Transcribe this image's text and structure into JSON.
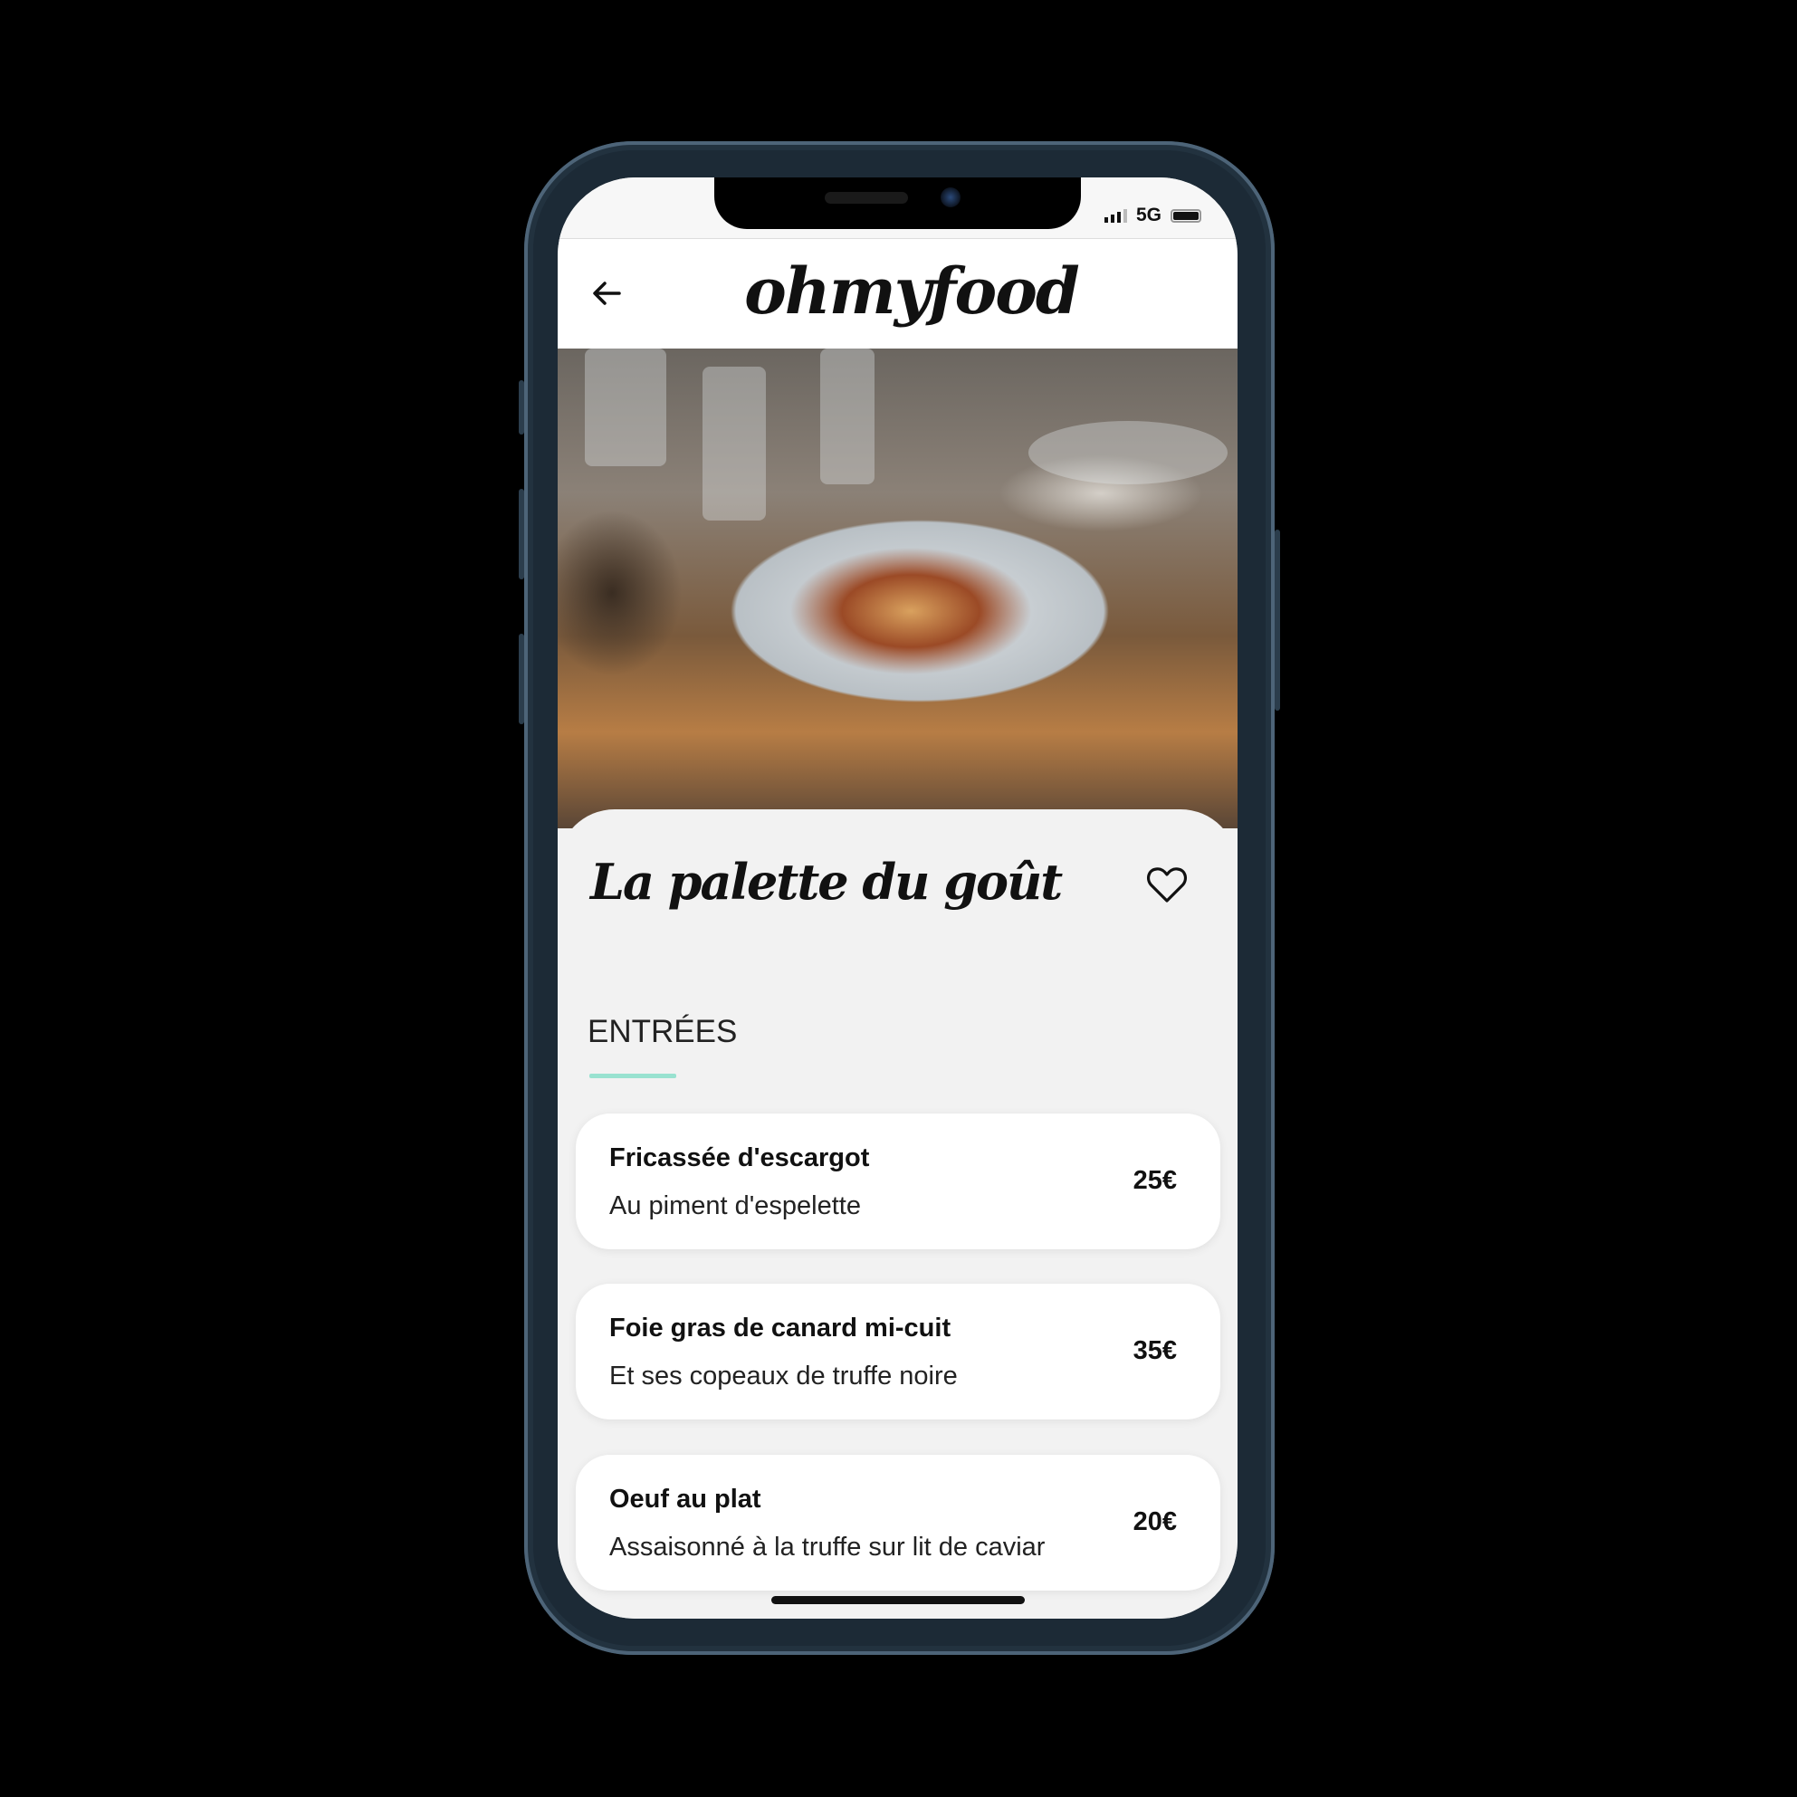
{
  "status_bar": {
    "network": "5G",
    "signal_icon": "signal-bars-icon",
    "battery_icon": "battery-icon"
  },
  "header": {
    "back_icon": "arrow-left-icon",
    "logo": "ohmyfood"
  },
  "restaurant": {
    "name": "La palette du goût",
    "favorite_icon": "heart-outline-icon"
  },
  "section": {
    "title": "ENTRÉES",
    "accent_color": "#99e2d0"
  },
  "menu": [
    {
      "name": "Fricassée d'escargot",
      "description": "Au piment d'espelette",
      "price": "25€"
    },
    {
      "name": "Foie gras de canard mi-cuit",
      "description": "Et ses copeaux de truffe noire",
      "price": "35€"
    },
    {
      "name": "Oeuf au plat",
      "description": "Assaisonné à la truffe sur lit de caviar",
      "price": "20€"
    }
  ]
}
